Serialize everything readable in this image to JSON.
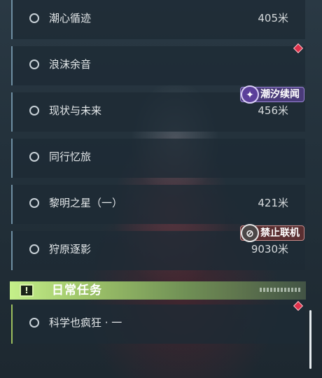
{
  "quests": [
    {
      "name": "潮心循迹",
      "distance": "405米"
    },
    {
      "name": "浪沫余音",
      "distance": ""
    },
    {
      "name": "现状与未来",
      "distance": "456米"
    },
    {
      "name": "同行忆旅",
      "distance": ""
    },
    {
      "name": "黎明之星（一）",
      "distance": "421米"
    },
    {
      "name": "狩原逐影",
      "distance": "9030米"
    }
  ],
  "badges": {
    "tide": {
      "label": "潮汐续闻",
      "icon": "✦"
    },
    "nocoop": {
      "label": "禁止联机",
      "icon": "⊘"
    }
  },
  "daily": {
    "section_title": "日常任务",
    "icon": "!",
    "items": [
      {
        "name": "科学也疯狂 · 一",
        "distance": ""
      }
    ]
  },
  "colors": {
    "daily_accent": "#9cbf5e",
    "marker": "#e0304a",
    "tide_badge": "#4a3b7a",
    "nocoop_badge": "#5a2f31"
  }
}
